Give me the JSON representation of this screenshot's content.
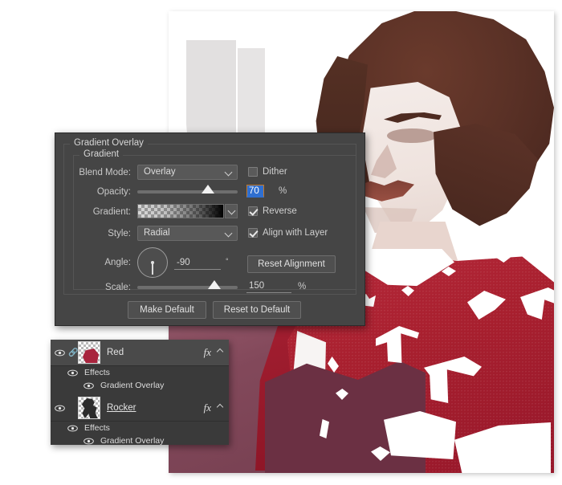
{
  "photo": {
    "alt": "posterized portrait of a person with curly brown hair wearing a red graphic t-shirt"
  },
  "dialog": {
    "panel_title": "Gradient Overlay",
    "group_title": "Gradient",
    "rows": {
      "blend_mode": {
        "label": "Blend Mode:",
        "value": "Overlay"
      },
      "dither": {
        "label": "Dither",
        "checked": false
      },
      "opacity": {
        "label": "Opacity:",
        "value": "70",
        "unit": "%",
        "percent": 70
      },
      "gradient": {
        "label": "Gradient:",
        "swatch": "transparent-to-black"
      },
      "reverse": {
        "label": "Reverse",
        "checked": true
      },
      "style": {
        "label": "Style:",
        "value": "Radial"
      },
      "align_with_layer": {
        "label": "Align with Layer",
        "checked": true
      },
      "angle": {
        "label": "Angle:",
        "value": "-90",
        "unit": "°"
      },
      "reset_alignment": {
        "label": "Reset Alignment"
      },
      "scale": {
        "label": "Scale:",
        "value": "150",
        "unit": "%",
        "percent": 77
      }
    },
    "footer": {
      "make_default": "Make Default",
      "reset_to_default": "Reset to Default"
    }
  },
  "layers": {
    "items": [
      {
        "name": "Red",
        "selected": true,
        "editing": false,
        "linked": true,
        "fx": "fx",
        "thumb": "red-blob",
        "effects_label": "Effects",
        "effect_name": "Gradient Overlay"
      },
      {
        "name": "Rocker",
        "selected": false,
        "editing": true,
        "linked": false,
        "fx": "fx",
        "thumb": "figure",
        "effects_label": "Effects",
        "effect_name": "Gradient Overlay"
      }
    ]
  },
  "colors": {
    "panel_bg": "#454545",
    "layers_bg": "#3a3a3a",
    "accent_select": "#2f6fd0",
    "focus_border": "#c57a28",
    "shirt_red": "#a9202f",
    "hair_brown": "#5a3126"
  }
}
